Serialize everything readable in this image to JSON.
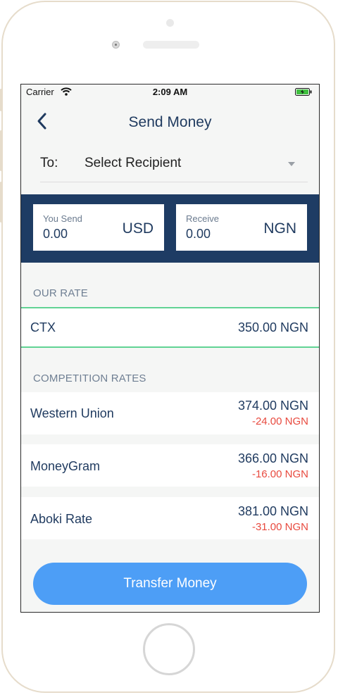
{
  "status_bar": {
    "carrier": "Carrier",
    "time": "2:09 AM",
    "battery_color": "#3fbf3f"
  },
  "header": {
    "title": "Send Money",
    "back_icon": "chevron-left-icon"
  },
  "recipient": {
    "label": "To:",
    "value": "Select Recipient",
    "dropdown_icon": "caret-down-icon"
  },
  "amounts": {
    "send": {
      "label": "You Send",
      "value": "0.00",
      "currency": "USD"
    },
    "receive": {
      "label": "Receive",
      "value": "0.00",
      "currency": "NGN"
    }
  },
  "our_rate": {
    "section_label": "OUR RATE",
    "name": "CTX",
    "value": "350.00 NGN"
  },
  "competition": {
    "section_label": "COMPETITION RATES",
    "items": [
      {
        "name": "Western Union",
        "value": "374.00 NGN",
        "diff": "-24.00 NGN"
      },
      {
        "name": "MoneyGram",
        "value": "366.00 NGN",
        "diff": "-16.00 NGN"
      },
      {
        "name": "Aboki Rate",
        "value": "381.00 NGN",
        "diff": "-31.00 NGN"
      }
    ]
  },
  "actions": {
    "transfer_label": "Transfer Money"
  },
  "colors": {
    "navy": "#1e3c64",
    "accent_blue": "#4d9ef6",
    "highlight_green": "#61d394",
    "negative_red": "#e84a3f"
  }
}
